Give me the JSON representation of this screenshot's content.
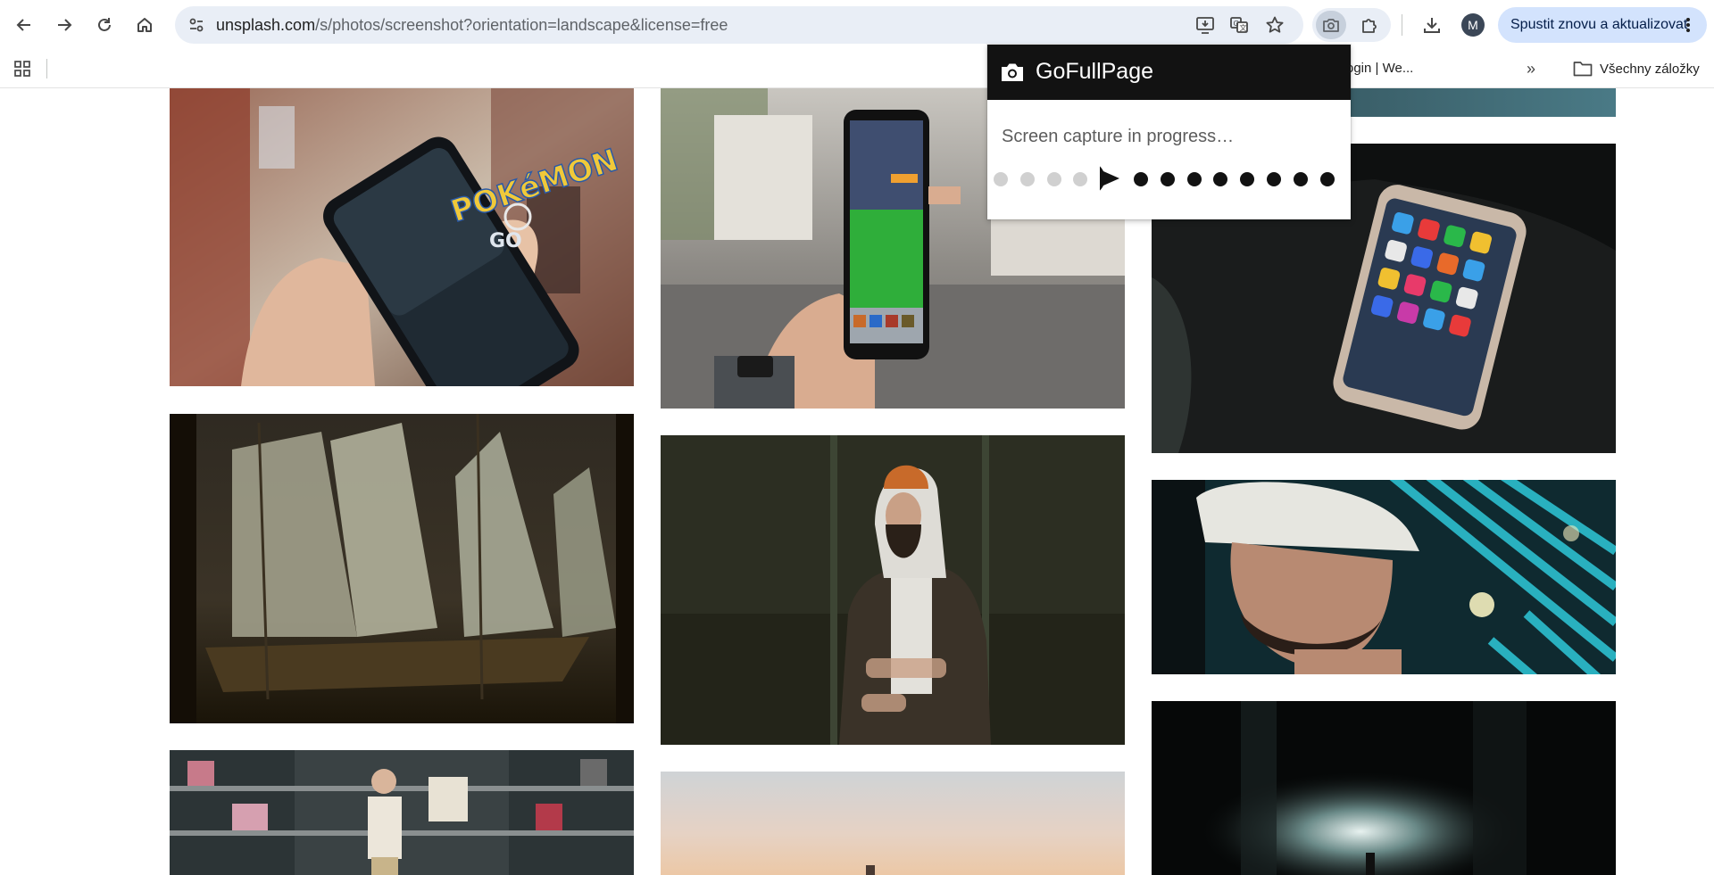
{
  "browser": {
    "url_host": "unsplash.com",
    "url_path": "/s/photos/screenshot?orientation=landscape&license=free",
    "profile_initial": "M",
    "update_button_label": "Spustit znovu a aktualizovat",
    "nav": [
      "back-icon",
      "forward-icon",
      "reload-icon",
      "home-icon"
    ],
    "omnibox_icons": [
      "install-app-icon",
      "translate-icon",
      "bookmark-star-icon"
    ],
    "toolbar_icons": [
      "gofullpage-extension-icon",
      "extensions-puzzle-icon",
      "downloads-icon"
    ]
  },
  "bookmarks": {
    "items": [
      {
        "label": "ogin | We..."
      }
    ],
    "overflow_label": "»",
    "all_bookmarks_label": "Všechny záložky"
  },
  "gofullpage": {
    "title": "GoFullPage",
    "status": "Screen capture in progress…",
    "progress": {
      "completed_steps": 4,
      "total_steps": 13
    }
  },
  "gallery": {
    "photos": [
      {
        "subject": "hand holding phone showing Pokémon GO"
      },
      {
        "subject": "hand holding phone showing pixel game"
      },
      {
        "subject": "smartphone with app icons in dark"
      },
      {
        "subject": "sailing ship model with sails"
      },
      {
        "subject": "bearded man in hoodie and orange beanie"
      },
      {
        "subject": "bearded man in cap with cyan lights"
      },
      {
        "subject": "man with bags in a store"
      },
      {
        "subject": "sunset sky"
      },
      {
        "subject": "dark alley with bright light"
      }
    ]
  },
  "photo_texts": {
    "pokemon_logo": "POKéMON",
    "pokemon_go": "GO"
  }
}
